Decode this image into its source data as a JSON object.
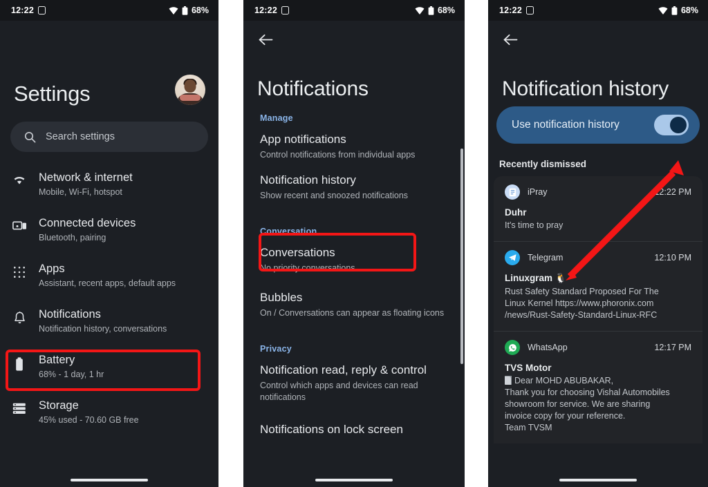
{
  "colors": {
    "panel_bg": "#1c1f24",
    "statusbar_bg": "#15171a",
    "accent_section": "#8ab4e8",
    "highlight_red": "#f31616",
    "banner_blue": "#2d5a87",
    "toggle_track": "#aac8e9",
    "toggle_thumb": "#0e2b47",
    "card_bg": "#222428"
  },
  "status_bar": {
    "time": "12:22",
    "battery_percent": "68%",
    "icons": [
      "screen-record-icon",
      "wifi-icon",
      "battery-icon"
    ]
  },
  "settings_screen": {
    "title": "Settings",
    "avatar_name": "user-avatar",
    "search": {
      "placeholder": "Search settings",
      "icon": "search-icon"
    },
    "items": [
      {
        "icon": "wifi-icon",
        "title": "Network & internet",
        "subtitle": "Mobile, Wi-Fi, hotspot"
      },
      {
        "icon": "connected-devices-icon",
        "title": "Connected devices",
        "subtitle": "Bluetooth, pairing"
      },
      {
        "icon": "apps-grid-icon",
        "title": "Apps",
        "subtitle": "Assistant, recent apps, default apps"
      },
      {
        "icon": "bell-icon",
        "title": "Notifications",
        "subtitle": "Notification history, conversations",
        "highlighted": true
      },
      {
        "icon": "battery-icon",
        "title": "Battery",
        "subtitle": "68% - 1 day, 1 hr"
      },
      {
        "icon": "storage-icon",
        "title": "Storage",
        "subtitle": "45% used - 70.60 GB free"
      }
    ]
  },
  "notifications_screen": {
    "back_icon": "back-arrow-icon",
    "title": "Notifications",
    "sections": [
      {
        "label": "Manage",
        "items": [
          {
            "title": "App notifications",
            "subtitle": "Control notifications from individual apps"
          },
          {
            "title": "Notification history",
            "subtitle": "Show recent and snoozed notifications",
            "highlighted": true
          }
        ]
      },
      {
        "label": "Conversation",
        "items": [
          {
            "title": "Conversations",
            "subtitle": "No priority conversations"
          },
          {
            "title": "Bubbles",
            "subtitle": "On / Conversations can appear as floating icons"
          }
        ]
      },
      {
        "label": "Privacy",
        "items": [
          {
            "title": "Notification read, reply & control",
            "subtitle": "Control which apps and devices can read notifications"
          },
          {
            "title": "Notifications on lock screen",
            "subtitle": ""
          }
        ]
      }
    ]
  },
  "history_screen": {
    "back_icon": "back-arrow-icon",
    "title": "Notification history",
    "banner": {
      "label": "Use notification history",
      "toggle_state": "on"
    },
    "recent_header": "Recently dismissed",
    "notifications": [
      {
        "app": "iPray",
        "app_icon": "ipray-icon",
        "icon_color": "#c9dcf5",
        "time": "12:22 PM",
        "title": "Duhr",
        "body": "It's time to pray"
      },
      {
        "app": "Telegram",
        "app_icon": "telegram-icon",
        "icon_color": "#2aabee",
        "time": "12:10 PM",
        "title": "Linuxgram 🐧",
        "body": "Rust Safety Standard Proposed For The\nLinux Kernel https://www.phoronix.com\n/news/Rust-Safety-Standard-Linux-RFC"
      },
      {
        "app": "WhatsApp",
        "app_icon": "whatsapp-icon",
        "icon_color": "#1faa54",
        "time": "12:17 PM",
        "title": "TVS Motor",
        "body_first": "Dear MOHD ABUBAKAR,",
        "body": "Thank you for choosing Vishal Automobiles\nshowroom for service. We are sharing\ninvoice copy for your reference.\nTeam TVSM"
      }
    ]
  }
}
